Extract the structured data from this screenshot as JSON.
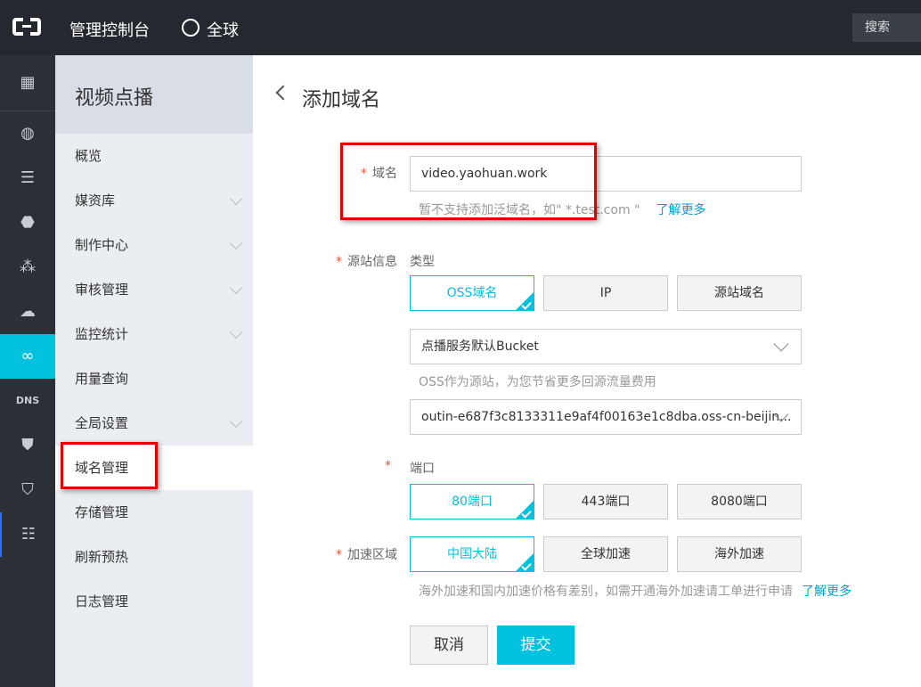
{
  "topbar": {
    "title": "管理控制台",
    "region": "全球",
    "search": "搜索"
  },
  "rail": {
    "icons": [
      "apps-grid-icon",
      "globe-icon",
      "server-icon",
      "database-icon",
      "network-icon",
      "cloud-upload-icon",
      "video-on-demand-icon",
      "dns-icon",
      "shield-icon",
      "security-monitor-icon",
      "storage-cloud-icon"
    ],
    "active_index": 6
  },
  "sidebar": {
    "title": "视频点播",
    "items": [
      {
        "label": "概览",
        "expandable": false
      },
      {
        "label": "媒资库",
        "expandable": true
      },
      {
        "label": "制作中心",
        "expandable": true
      },
      {
        "label": "审核管理",
        "expandable": true
      },
      {
        "label": "监控统计",
        "expandable": true
      },
      {
        "label": "用量查询",
        "expandable": false
      },
      {
        "label": "全局设置",
        "expandable": true
      },
      {
        "label": "域名管理",
        "expandable": false,
        "active": true
      },
      {
        "label": "存储管理",
        "expandable": false
      },
      {
        "label": "刷新预热",
        "expandable": false
      },
      {
        "label": "日志管理",
        "expandable": false
      }
    ]
  },
  "page": {
    "title": "添加域名"
  },
  "form": {
    "domain": {
      "label": "域名",
      "value": "video.yaohuan.work",
      "hint": "暂不支持添加泛域名，如\" *.test.com \"",
      "link": "了解更多"
    },
    "origin": {
      "label": "源站信息",
      "type_label": "类型",
      "types": [
        "OSS域名",
        "IP",
        "源站域名"
      ],
      "selected_type": "OSS域名",
      "bucket_select": "点播服务默认Bucket",
      "hint": "OSS作为源站，为您节省更多回源流量费用",
      "bucket_domain": "outin-e687f3c8133311e9af4f00163e1c8dba.oss-cn-beijin..."
    },
    "port": {
      "label": "端口",
      "options": [
        "80端口",
        "443端口",
        "8080端口"
      ],
      "selected": "80端口"
    },
    "region": {
      "label": "加速区域",
      "options": [
        "中国大陆",
        "全球加速",
        "海外加速"
      ],
      "selected": "中国大陆",
      "hint": "海外加速和国内加速价格有差别，如需开通海外加速请工单进行申请",
      "link": "了解更多"
    },
    "cancel": "取消",
    "submit": "提交"
  },
  "colors": {
    "accent": "#00c1de",
    "highlight_box": "#e50000",
    "topbar": "#25292f"
  }
}
